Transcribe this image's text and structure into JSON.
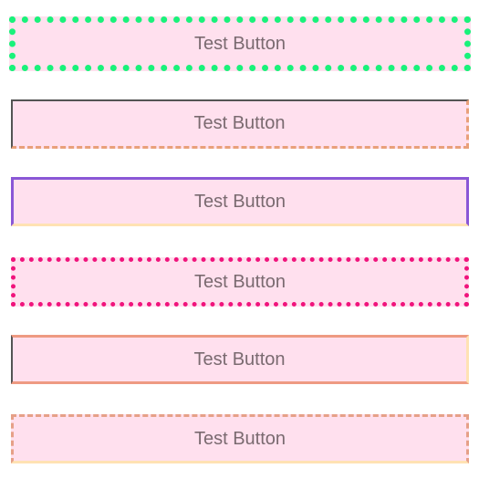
{
  "buttons": [
    {
      "label": "Test Button",
      "border_color": "#19f27a",
      "border_style": "dotted"
    },
    {
      "label": "Test Button",
      "border_color": "#e9a07a",
      "border_style": "dashed"
    },
    {
      "label": "Test Button",
      "border_color": "#8a57d6",
      "border_style": "solid"
    },
    {
      "label": "Test Button",
      "border_color": "#f0147c",
      "border_style": "dotted"
    },
    {
      "label": "Test Button",
      "border_color": "#ee9a82",
      "border_style": "solid"
    },
    {
      "label": "Test Button",
      "border_color": "#e6a088",
      "border_style": "dashed"
    }
  ],
  "colors": {
    "button_background": "#ffe0ee",
    "button_text": "#7a6a70"
  }
}
